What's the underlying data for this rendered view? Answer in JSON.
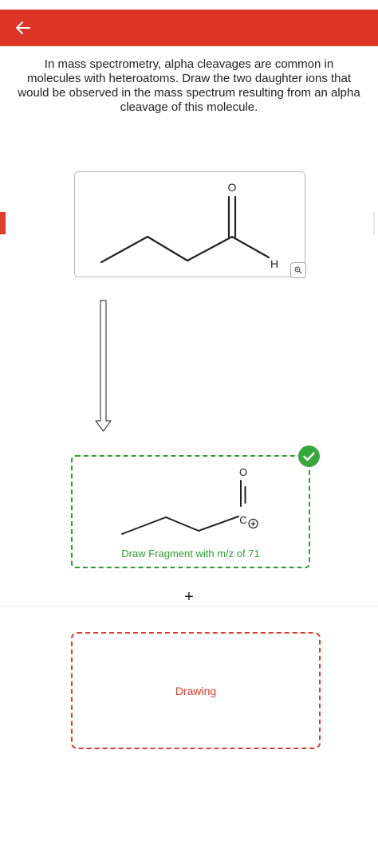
{
  "header": {
    "back_icon": "arrow-left-icon",
    "background_color": "#dc3526"
  },
  "question": {
    "text": "In mass spectrometry, alpha cleavages are common in molecules with heteroatoms. Draw the two daughter ions that would be observed in the mass spectrum resulting from an alpha cleavage of this molecule."
  },
  "molecule": {
    "oxygen_label": "O",
    "hydrogen_label": "H",
    "zoom_icon": "zoom-in-icon"
  },
  "fragment_1": {
    "oxygen_label": "O",
    "carbon_label": "C",
    "charge_symbol": "+",
    "label": "Draw Fragment with m/z of 71",
    "status": "correct",
    "status_icon": "checkmark-icon",
    "border_color": "#2e9d33"
  },
  "separator": {
    "plus": "+"
  },
  "fragment_2": {
    "label": "Drawing",
    "border_color": "#e03a2c"
  }
}
